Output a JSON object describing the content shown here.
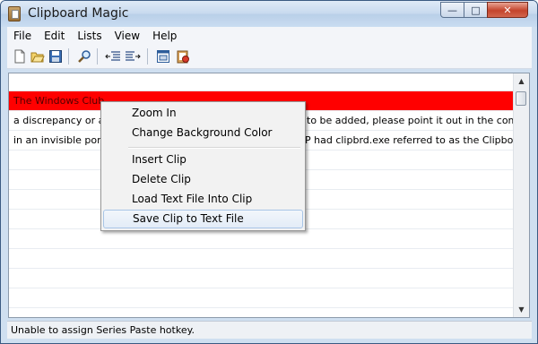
{
  "window": {
    "title": "Clipboard Magic",
    "controls": {
      "minimize": "—",
      "maximize": "□",
      "close": "✕"
    }
  },
  "menubar": [
    "File",
    "Edit",
    "Lists",
    "View",
    "Help"
  ],
  "toolbar": {
    "buttons": [
      "new-icon",
      "open-folder-icon",
      "save-icon",
      "search-icon",
      "indent-left-icon",
      "indent-right-icon",
      "properties-icon",
      "clipboard-settings-icon"
    ]
  },
  "clips": [
    {
      "text": "The Windows Club",
      "selected": true
    },
    {
      "text": "a discrepancy or a n",
      "text_right": "to be added, please point it out in the comments",
      "selected": false
    },
    {
      "text": "in an invisible portio",
      "text_right": "P had clipbrd.exe referred to as the Clipboard V",
      "selected": false
    }
  ],
  "context_menu": {
    "items": [
      "Zoom In",
      "Change Background Color",
      "Insert Clip",
      "Delete Clip",
      "Load Text File Into Clip",
      "Save Clip to Text File"
    ],
    "hover_item": "Save Clip to Text File"
  },
  "status_text": "Unable to assign Series Paste hotkey.",
  "colors": {
    "selected_row": "#ff0000",
    "menu_hover_border": "#a8c5e6"
  }
}
